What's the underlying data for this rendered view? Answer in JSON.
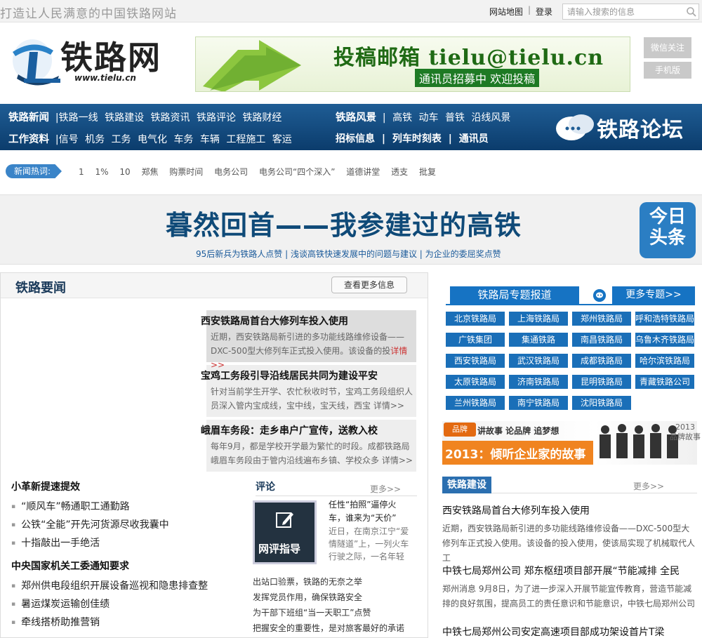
{
  "topbar": {
    "slogan": "打造让人民满意的中国铁路网站",
    "sitemap": "网站地图",
    "separator": "|",
    "login": "登录",
    "search_placeholder": "请输入搜索的信息"
  },
  "header": {
    "logo_text": "铁路网",
    "logo_url": "www.tielu.cn",
    "banner_title": "投稿邮箱 tielu@tielu.cn",
    "banner_sub": "通讯员招募中 欢迎投稿",
    "wechat": "微信关注",
    "mobile": "手机版"
  },
  "nav": {
    "row1_label": "铁路新闻",
    "row1": [
      "|铁路一线",
      "铁路建设",
      "铁路资讯",
      "铁路评论",
      "铁路财经"
    ],
    "row2_label": "工作资料",
    "row2": [
      "|信号",
      "机务",
      "工务",
      "电气化",
      "车务",
      "车辆",
      "工程施工",
      "客运"
    ],
    "row1_right_label": "铁路风景",
    "row1_right": [
      "|",
      "高铁",
      "动车",
      "普铁",
      "沿线风景"
    ],
    "row2_right": [
      "招标信息",
      "|",
      "列车时刻表",
      "|",
      "通讯员"
    ],
    "forum": "铁路论坛"
  },
  "hot": {
    "label": "新闻热词:",
    "words": [
      "1",
      "1%",
      "10",
      "郑焦",
      "购票时间",
      "电务公司",
      "电务公司“四个深入”",
      "道德讲堂",
      "透支",
      "批复"
    ]
  },
  "headline": {
    "title": "暮然回首——我参建过的高铁",
    "sub": "95后新兵为铁路人点赞 | 浅谈高铁快速发展中的问题与建议 | 为企业的委屈奖点赞",
    "today_line1": "今日",
    "today_line2": "头条"
  },
  "news": {
    "title": "铁路要闻",
    "more": "查看更多信息",
    "items": [
      {
        "title": "西安铁路局首台大修列车投入使用",
        "desc": "近期，西安铁路局新引进的多功能线路维修设备——DXC-500型大修列车正式投入使用。该设备的投",
        "link": "详情>>"
      },
      {
        "title": "宝鸡工务段引导沿线居民共同为建设平安",
        "desc": "针对当前学生开学、农忙秋收时节，宝鸡工务段组织人员深入管内宝成线，宝中线，宝天线，西宝 ",
        "link": "详情>>"
      },
      {
        "title": "峨眉车务段：走乡串户广宣传，送教入校",
        "desc": "每年9月，都是学校开学最为繁忙的时段。成都铁路局峨眉车务段由于管内沿线遍布乡镇、学校众多 ",
        "link": "详情>>"
      }
    ],
    "sec1_title": "小革新提速提效",
    "sec1_items": [
      "“顺风车”畅通职工通勤路",
      "公铁“全能”开先河货源尽收我囊中",
      "十指敲出一手绝活"
    ],
    "sec2_title": "中央国家机关工委通知要求",
    "sec2_items": [
      "郑州供电段组织开展设备巡视和隐患排查整",
      "暑运煤炭运输创佳绩",
      "牵线搭桥助推营销"
    ]
  },
  "comment": {
    "title": "评论",
    "more": "更多>>",
    "box_label": "网评指导",
    "feature_title": "任性“拍照”逼停火车，谁来为“天价”",
    "feature_desc": "近日，在南京江宁“爱情隧道”上，一列火车行驶之际，一名年轻",
    "list": [
      "出站口验票，铁路的无奈之举",
      "发挥党员作用，确保铁路安全",
      "为干部下班组“当一天职工”点赞",
      "把握安全的重要性，是对旅客最好的承诺"
    ]
  },
  "bureau": {
    "title": "铁路局专题报道",
    "more": "更多专题>>",
    "items": [
      "北京铁路局",
      "上海铁路局",
      "郑州铁路局",
      "呼和浩特铁路局",
      "广铁集团",
      "集通铁路",
      "南昌铁路局",
      "乌鲁木齐铁路局",
      "西安铁路局",
      "武汉铁路局",
      "成都铁路局",
      "哈尔滨铁路局",
      "太原铁路局",
      "济南铁路局",
      "昆明铁路局",
      "青藏铁路公司",
      "兰州铁路局",
      "南宁铁路局",
      "沈阳铁路局"
    ]
  },
  "brand": {
    "tag": "品牌",
    "slogan": "讲故事  论品牌  追梦想",
    "main": "2013：倾听企业家的故事",
    "year": "2013",
    "year_sub": "品牌故事"
  },
  "construction": {
    "title": "铁路建设",
    "more": "更多>>",
    "items": [
      {
        "title": "西安铁路局首台大修列车投入使用",
        "desc": "近期，西安铁路局新引进的多功能线路维修设备——DXC-500型大修列车正式投入使用。该设备的投入使用，使该局实现了机械取代人工"
      },
      {
        "title": "中铁七局郑州公司  郑东枢纽项目部开展“节能减排 全民",
        "desc": "郑州消息 9月8日，为了进一步深入开展节能宣传教育，营造节能减排的良好氛围，提高员工的责任意识和节能意识，中铁七局郑州公司"
      },
      {
        "title": "中铁七局郑州公司安定高速项目部成功架设首片T梁",
        "desc": ""
      }
    ]
  },
  "colors": {
    "nav_bg": "#0b3c6c",
    "accent": "#1673c3",
    "brand_orange": "#f08420"
  }
}
